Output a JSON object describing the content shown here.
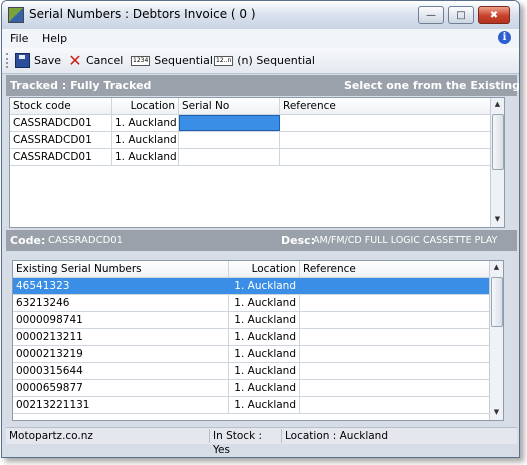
{
  "window": {
    "title": "Serial Numbers : Debtors Invoice ( 0 )",
    "controls": [
      "minimize",
      "maximize",
      "close"
    ]
  },
  "menu": [
    "File",
    "Help"
  ],
  "toolbar": {
    "save": "Save",
    "cancel": "Cancel",
    "sequential": "Sequential",
    "n_sequential": "(n) Sequential",
    "seq_icon_text": "1234",
    "nseq_icon_text": "12..n"
  },
  "tracked_bar": {
    "left": "Tracked : Fully Tracked",
    "right": "Select one from the Existing grid"
  },
  "top_grid": {
    "columns": [
      "Stock code",
      "Location",
      "Serial No",
      "Reference"
    ],
    "rows": [
      {
        "stock_code": "CASSRADCD01",
        "location": "1. Auckland",
        "serial_no": "",
        "reference": ""
      },
      {
        "stock_code": "CASSRADCD01",
        "location": "1. Auckland",
        "serial_no": "",
        "reference": ""
      },
      {
        "stock_code": "CASSRADCD01",
        "location": "1. Auckland",
        "serial_no": "",
        "reference": ""
      }
    ]
  },
  "code_bar": {
    "code_label": "Code:",
    "code_value": "CASSRADCD01",
    "desc_label": "Desc:",
    "desc_value": "AM/FM/CD FULL LOGIC CASSETTE PLAY"
  },
  "existing_grid": {
    "columns": [
      "Existing Serial Numbers",
      "Location",
      "Reference"
    ],
    "rows": [
      {
        "serial": "46541323",
        "location": "1. Auckland",
        "reference": "",
        "selected": true
      },
      {
        "serial": "63213246",
        "location": "1. Auckland",
        "reference": ""
      },
      {
        "serial": "0000098741",
        "location": "1. Auckland",
        "reference": ""
      },
      {
        "serial": "0000213211",
        "location": "1. Auckland",
        "reference": ""
      },
      {
        "serial": "0000213219",
        "location": "1. Auckland",
        "reference": ""
      },
      {
        "serial": "0000315644",
        "location": "1. Auckland",
        "reference": ""
      },
      {
        "serial": "0000659877",
        "location": "1. Auckland",
        "reference": ""
      },
      {
        "serial": "00213221131",
        "location": "1. Auckland",
        "reference": ""
      }
    ]
  },
  "status": {
    "company": "Motopartz.co.nz",
    "in_stock": "In Stock : Yes",
    "location": "Location : Auckland"
  },
  "colors": {
    "selection": "#3a8ee6",
    "section_bar": "#9aa1aa"
  }
}
